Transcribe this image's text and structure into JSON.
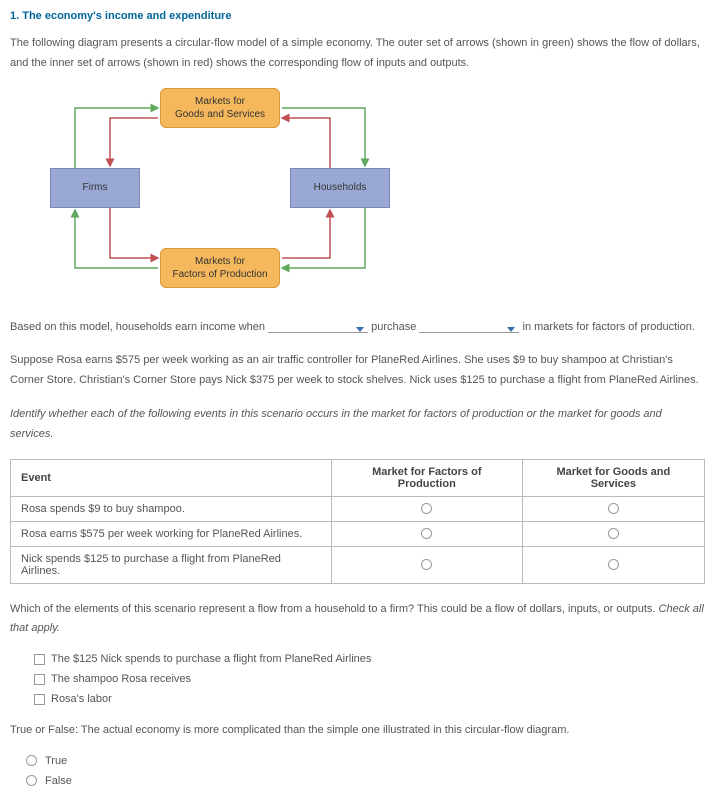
{
  "title": "1. The economy's income and expenditure",
  "intro": "The following diagram presents a circular-flow model of a simple economy. The outer set of arrows (shown in green) shows the flow of dollars, and the inner set of arrows (shown in red) shows the corresponding flow of inputs and outputs.",
  "diagram": {
    "markets_goods": "Markets for\nGoods and Services",
    "firms": "Firms",
    "households": "Households",
    "markets_factors": "Markets for\nFactors of Production"
  },
  "fill_sentence": {
    "prefix": "Based on this model, households earn income when",
    "mid": "purchase",
    "suffix": "in markets for factors of production."
  },
  "scenario": "Suppose Rosa earns $575 per week working as an air traffic controller for PlaneRed Airlines. She uses $9 to buy shampoo at Christian's Corner Store. Christian's Corner Store pays Nick $375 per week to stock shelves. Nick uses $125 to purchase a flight from PlaneRed Airlines.",
  "identify_prompt": "Identify whether each of the following events in this scenario occurs in the market for factors of production or the market for goods and services.",
  "table": {
    "h_event": "Event",
    "h_factors": "Market for Factors of Production",
    "h_goods": "Market for Goods and Services",
    "rows": [
      {
        "event": "Rosa spends $9 to buy shampoo."
      },
      {
        "event": "Rosa earns $575 per week working for PlaneRed Airlines."
      },
      {
        "event": "Nick spends $125 to purchase a flight from PlaneRed Airlines."
      }
    ]
  },
  "which_prompt": {
    "text": "Which of the elements of this scenario represent a flow from a household to a firm? This could be a flow of dollars, inputs, or outputs. ",
    "italic": "Check all that apply."
  },
  "check_options": [
    "The $125 Nick spends to purchase a flight from PlaneRed Airlines",
    "The shampoo Rosa receives",
    "Rosa's labor"
  ],
  "tf_prompt": "True or False: The actual economy is more complicated than the simple one illustrated in this circular-flow diagram.",
  "tf_options": {
    "true": "True",
    "false": "False"
  }
}
